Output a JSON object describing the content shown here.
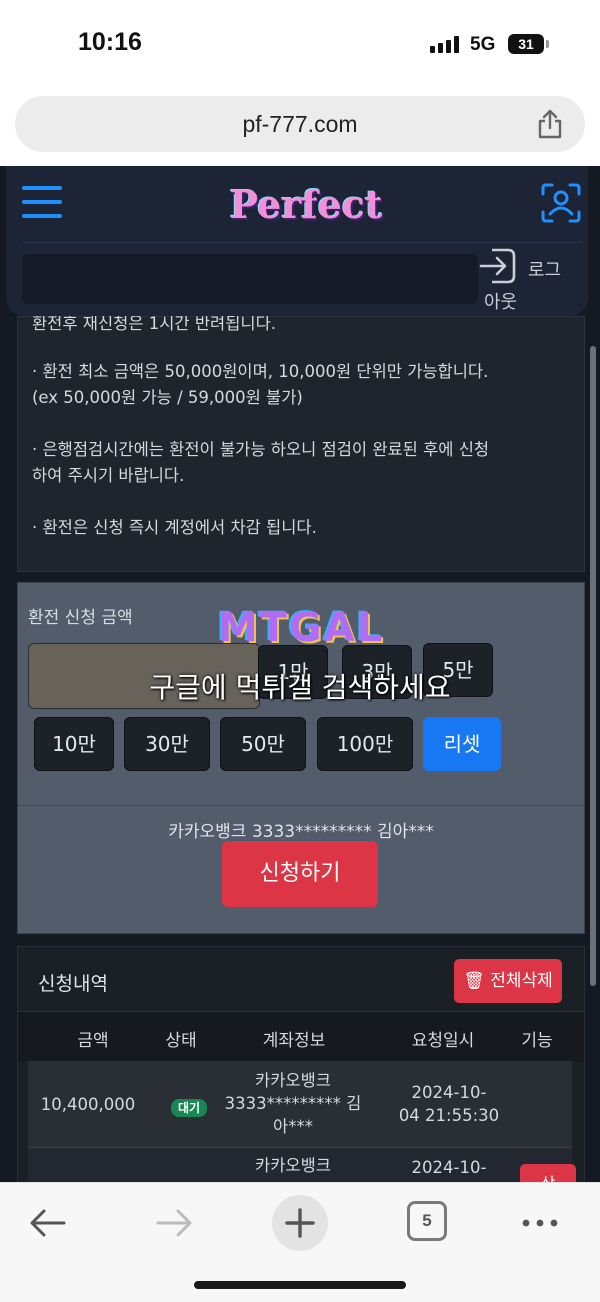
{
  "status_bar": {
    "time": "10:16",
    "network": "5G",
    "battery": "31"
  },
  "browser": {
    "url": "pf-777.com",
    "tab_count": "5"
  },
  "header": {
    "logo": "Perfect",
    "logout_label_1": "로그",
    "logout_label_2": "아웃"
  },
  "notice": {
    "line_partial": "환전후 재신청은 1시간 반려됩니다.",
    "line1a": "· 환전 최소 금액은 50,000원이며, 10,000원 단위만 가능합니다.",
    "line1b": "(ex 50,000원 가능 / 59,000원 불가)",
    "line2a": "· 은행점검시간에는 환전이 불가능 하오니 점검이 완료된 후에 신청",
    "line2b": "하여 주시기 바랍니다.",
    "line3": "· 환전은 신청 즉시 계정에서 차감 됩니다."
  },
  "form": {
    "label": "환전 신청 금액",
    "amount_value": "",
    "chips_row1": [
      "1만",
      "3만",
      "5만"
    ],
    "chips_row2": [
      "10만",
      "30만",
      "50만",
      "100만",
      "리셋"
    ],
    "bank_info": "카카오뱅크 3333********* 김아***",
    "apply_label": "신청하기"
  },
  "history": {
    "title": "신청내역",
    "delete_all_label": "전체삭제",
    "columns": [
      "금액",
      "상태",
      "계좌정보",
      "요청일시",
      "기능"
    ],
    "rows": [
      {
        "amount": "10,400,000",
        "status": "대기",
        "account_1": "카카오뱅크",
        "account_2": "3333********* 김",
        "account_3": "아***",
        "date_1": "2024-10-",
        "date_2": "04 21:55:30"
      },
      {
        "account_1": "카카오뱅크",
        "date_1": "2024-10-",
        "action": "삭"
      }
    ]
  },
  "watermark": {
    "logo": "MTGAL",
    "text": "구글에 먹튀갤 검색하세요"
  },
  "colors": {
    "accent_blue": "#1877f2",
    "danger_red": "#dc3545",
    "success_green": "#198754"
  }
}
